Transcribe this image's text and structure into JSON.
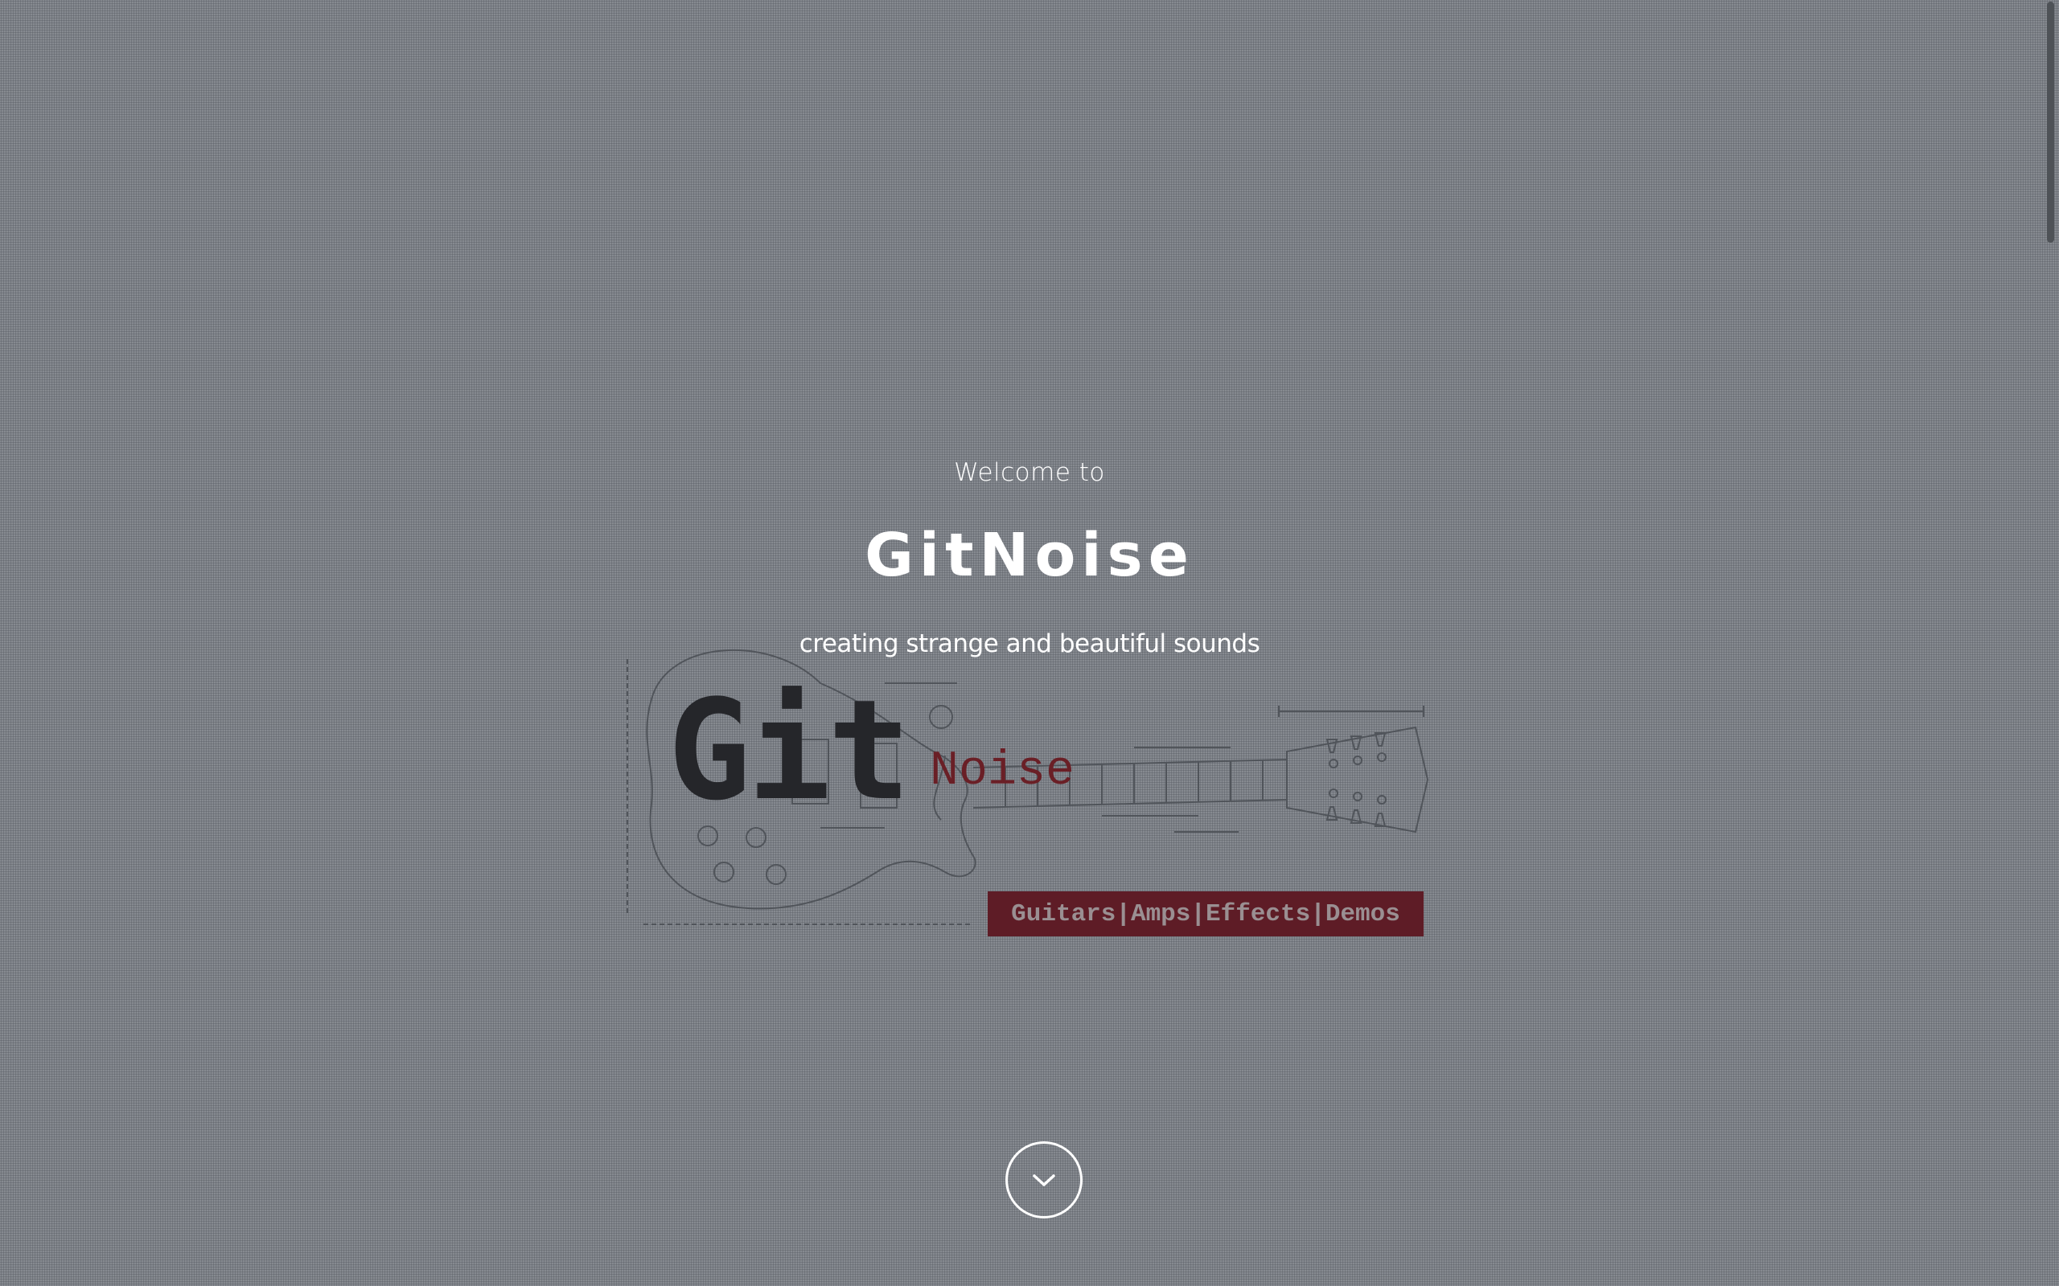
{
  "hero": {
    "welcome": "Welcome to",
    "title": "GitNoise",
    "tagline": "creating strange and beautiful sounds"
  },
  "logo": {
    "git": "Git",
    "noise": "Noise",
    "banner": "Guitars|Amps|Effects|Demos",
    "accent_color": "#5e1c26",
    "text_color": "#25262a"
  },
  "scroll_button": {
    "icon": "chevron-down-icon"
  },
  "colors": {
    "background": "#80848b",
    "text": "#ffffff"
  }
}
